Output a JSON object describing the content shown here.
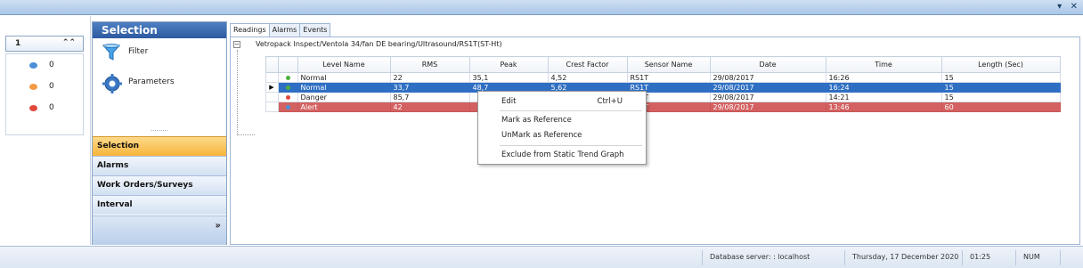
{
  "window": {
    "controls": [
      "▾",
      "✕"
    ]
  },
  "left": {
    "page_number": "1",
    "counts": [
      {
        "color": "#4a90d9",
        "value": "0"
      },
      {
        "color": "#f39c45",
        "value": "0"
      },
      {
        "color": "#e0483e",
        "value": "0"
      }
    ]
  },
  "selection_panel": {
    "title": "Selection",
    "tools": [
      {
        "label": "Filter",
        "icon": "filter-funnel-icon"
      },
      {
        "label": "Parameters",
        "icon": "parameters-gear-icon"
      }
    ],
    "nav": [
      "Selection",
      "Alarms",
      "Work Orders/Surveys",
      "Interval"
    ],
    "active_nav": "Selection"
  },
  "tabs": [
    "Readings",
    "Alarms",
    "Events"
  ],
  "active_tab": "Readings",
  "path": "Vetropack Inspect/Ventola 34/fan DE bearing/Ultrasound/RS1T(ST-Ht)",
  "grid": {
    "columns": [
      "Level Name",
      "RMS",
      "Peak",
      "Crest Factor",
      "Sensor Name",
      "Date",
      "Time",
      "Length (Sec)"
    ],
    "rows": [
      {
        "dot": "#4caf3c",
        "cells": [
          "Normal",
          "22",
          "35,1",
          "4,52",
          "RS1T",
          "29/08/2017",
          "16:26",
          "15"
        ],
        "state": ""
      },
      {
        "dot": "#4caf3c",
        "cells": [
          "Normal",
          "33,7",
          "48,7",
          "5,62",
          "RS1T",
          "29/08/2017",
          "16:24",
          "15"
        ],
        "state": "selected"
      },
      {
        "dot": "#e0483e",
        "cells": [
          "Danger",
          "85,7",
          "",
          "",
          "RS1T",
          "29/08/2017",
          "14:21",
          "15"
        ],
        "state": ""
      },
      {
        "dot": "#4a90d9",
        "cells": [
          "Alert",
          "42",
          "",
          "",
          "RS1T",
          "29/08/2017",
          "13:46",
          "60"
        ],
        "state": "alert"
      }
    ]
  },
  "context_menu": {
    "edit": "Edit",
    "edit_shortcut": "Ctrl+U",
    "mark_reference": "Mark as Reference",
    "unmark_reference": "UnMark as Reference",
    "exclude_static": "Exclude from Static Trend Graph"
  },
  "status": {
    "database": "Database server:  : localhost",
    "date": "Thursday, 17 December 2020",
    "time": "01:25",
    "num": "NUM"
  }
}
